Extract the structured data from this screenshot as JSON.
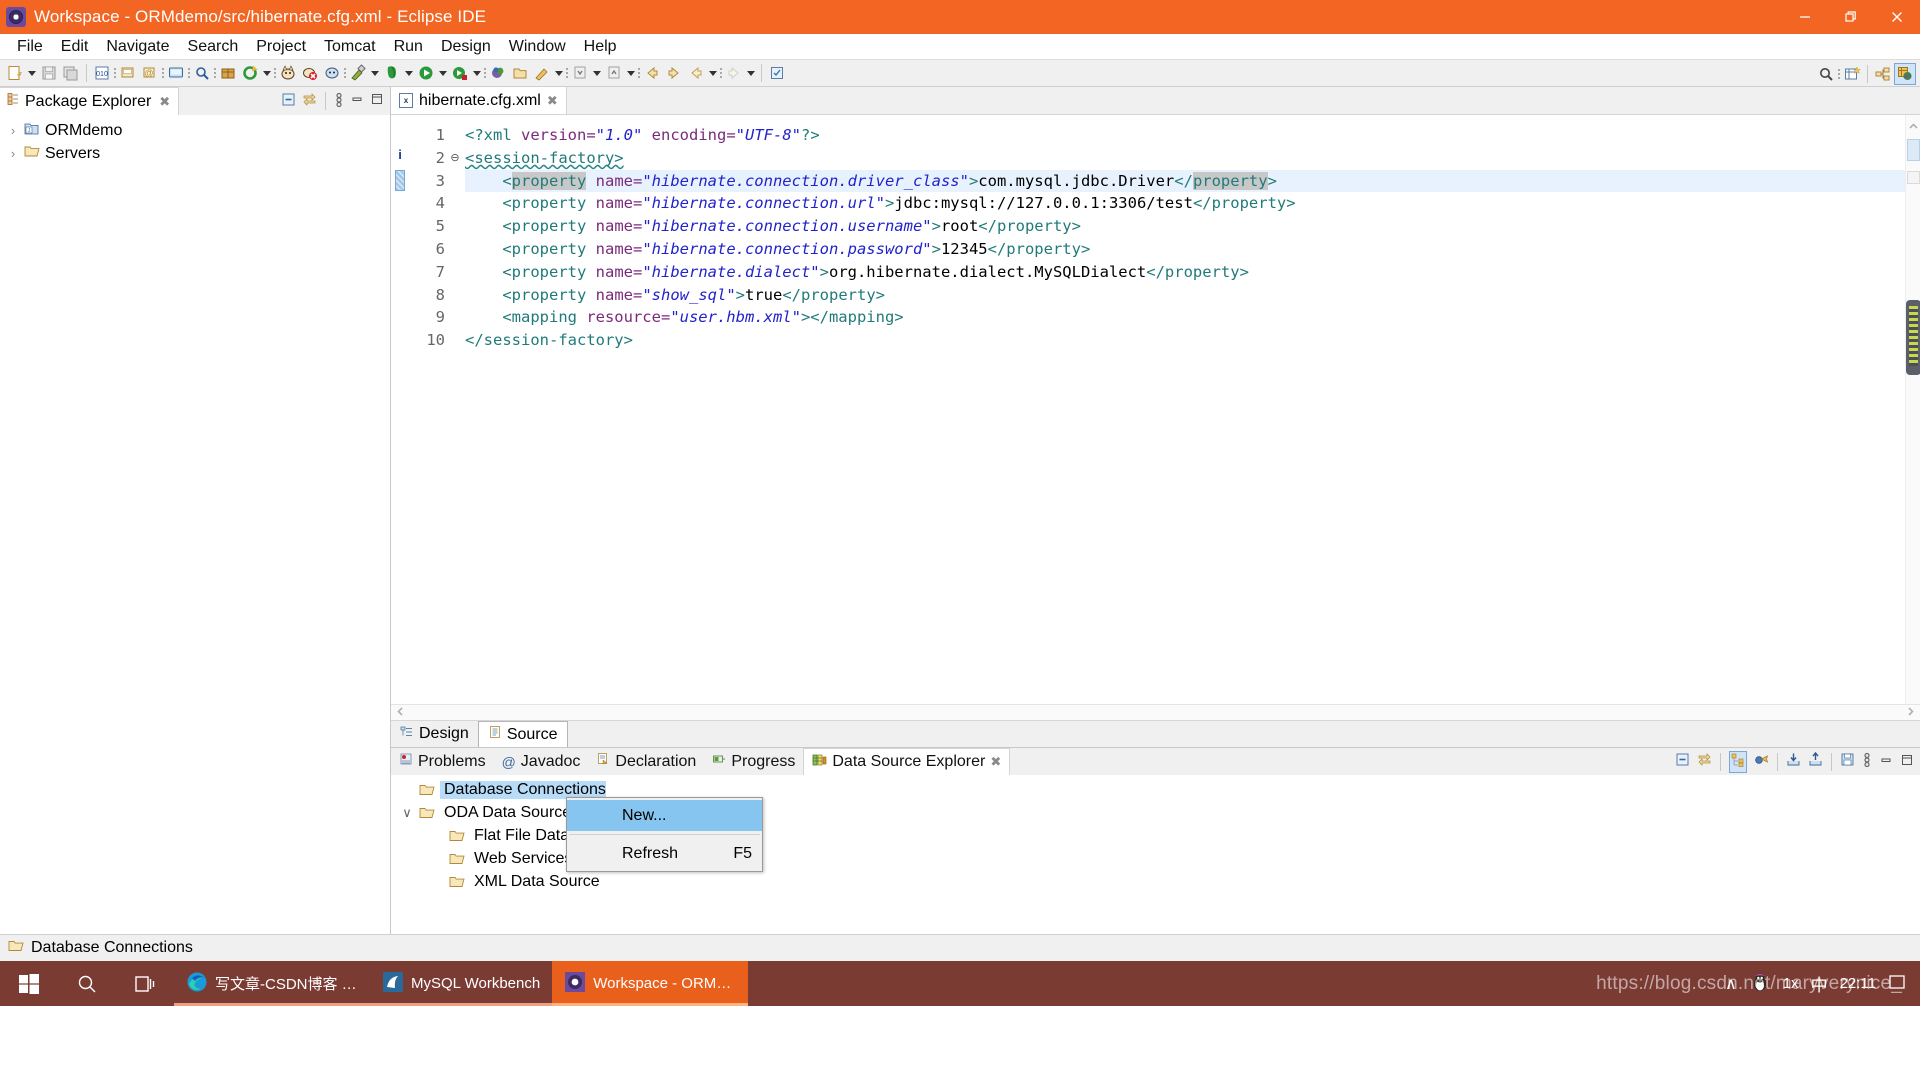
{
  "window": {
    "title": "Workspace - ORMdemo/src/hibernate.cfg.xml - Eclipse IDE",
    "app_icon": "eclipse-icon",
    "minimize_label": "Minimize",
    "restore_label": "Restore",
    "close_label": "Close",
    "accent_color": "#f26522"
  },
  "menubar": {
    "items": [
      {
        "label": "File"
      },
      {
        "label": "Edit"
      },
      {
        "label": "Navigate"
      },
      {
        "label": "Search"
      },
      {
        "label": "Project"
      },
      {
        "label": "Tomcat"
      },
      {
        "label": "Run"
      },
      {
        "label": "Design"
      },
      {
        "label": "Window"
      },
      {
        "label": "Help"
      }
    ]
  },
  "toolbar": {
    "right_icons": [
      "search-icon",
      "new-perspective-icon",
      "java-ee-perspective-icon",
      "web-perspective-icon"
    ]
  },
  "package_explorer": {
    "tab_label": "Package Explorer",
    "tab_icon": "package-explorer-icon",
    "close_label": "✖",
    "tools": [
      "collapse-all-icon",
      "link-with-editor-icon",
      "view-menu-icon",
      "minimize-icon",
      "maximize-icon"
    ],
    "tree": [
      {
        "label": "ORMdemo",
        "twisty": "›",
        "icon": "java-project-icon",
        "expanded": false
      },
      {
        "label": "Servers",
        "twisty": "›",
        "icon": "folder-icon",
        "expanded": false
      }
    ]
  },
  "editor": {
    "tab_label": "hibernate.cfg.xml",
    "tab_icon": "xml-file-icon",
    "tab_icon_text": "x",
    "close_label": "✖",
    "annotation_marker": "i",
    "line_numbers": [
      "1",
      "2",
      "3",
      "4",
      "5",
      "6",
      "7",
      "8",
      "9",
      "10"
    ],
    "fold_markers": {
      "2": "⊖"
    },
    "highlighted_line": 3,
    "lines": [
      {
        "n": 1,
        "segments": [
          {
            "t": "tag",
            "s": "<?xml "
          },
          {
            "t": "att",
            "s": "version="
          },
          {
            "t": "val",
            "s": "\"1.0\""
          },
          {
            "t": "att",
            "s": " encoding="
          },
          {
            "t": "val",
            "s": "\"UTF-8\""
          },
          {
            "t": "tag",
            "s": "?>"
          }
        ]
      },
      {
        "n": 2,
        "segments": [
          {
            "t": "tag-squiggle",
            "s": "<session-factory>"
          }
        ]
      },
      {
        "n": 3,
        "segments": [
          {
            "t": "plain",
            "s": "    "
          },
          {
            "t": "tag",
            "s": "<"
          },
          {
            "t": "tag-sel",
            "s": "property"
          },
          {
            "t": "att",
            "s": " name="
          },
          {
            "t": "val",
            "s": "\"hibernate.connection.driver_class\""
          },
          {
            "t": "tag",
            "s": ">"
          },
          {
            "t": "txt",
            "s": "com.mysql.jdbc.Driver"
          },
          {
            "t": "tag",
            "s": "</"
          },
          {
            "t": "tag-sel",
            "s": "property"
          },
          {
            "t": "tag",
            "s": ">"
          }
        ]
      },
      {
        "n": 4,
        "segments": [
          {
            "t": "plain",
            "s": "    "
          },
          {
            "t": "tag",
            "s": "<property"
          },
          {
            "t": "att",
            "s": " name="
          },
          {
            "t": "val",
            "s": "\"hibernate.connection.url\""
          },
          {
            "t": "tag",
            "s": ">"
          },
          {
            "t": "txt",
            "s": "jdbc:mysql://127.0.0.1:3306/test"
          },
          {
            "t": "tag",
            "s": "</property>"
          }
        ]
      },
      {
        "n": 5,
        "segments": [
          {
            "t": "plain",
            "s": "    "
          },
          {
            "t": "tag",
            "s": "<property"
          },
          {
            "t": "att",
            "s": " name="
          },
          {
            "t": "val",
            "s": "\"hibernate.connection.username\""
          },
          {
            "t": "tag",
            "s": ">"
          },
          {
            "t": "txt",
            "s": "root"
          },
          {
            "t": "tag",
            "s": "</property>"
          }
        ]
      },
      {
        "n": 6,
        "segments": [
          {
            "t": "plain",
            "s": "    "
          },
          {
            "t": "tag",
            "s": "<property"
          },
          {
            "t": "att",
            "s": " name="
          },
          {
            "t": "val",
            "s": "\"hibernate.connection.password\""
          },
          {
            "t": "tag",
            "s": ">"
          },
          {
            "t": "txt",
            "s": "12345"
          },
          {
            "t": "tag",
            "s": "</property>"
          }
        ]
      },
      {
        "n": 7,
        "segments": [
          {
            "t": "plain",
            "s": "    "
          },
          {
            "t": "tag",
            "s": "<property"
          },
          {
            "t": "att",
            "s": " name="
          },
          {
            "t": "val",
            "s": "\"hibernate.dialect\""
          },
          {
            "t": "tag",
            "s": ">"
          },
          {
            "t": "txt",
            "s": "org.hibernate.dialect.MySQLDialect"
          },
          {
            "t": "tag",
            "s": "</property>"
          }
        ]
      },
      {
        "n": 8,
        "segments": [
          {
            "t": "plain",
            "s": "    "
          },
          {
            "t": "tag",
            "s": "<property"
          },
          {
            "t": "att",
            "s": " name="
          },
          {
            "t": "val",
            "s": "\"show_sql\""
          },
          {
            "t": "tag",
            "s": ">"
          },
          {
            "t": "txt",
            "s": "true"
          },
          {
            "t": "tag",
            "s": "</property>"
          }
        ]
      },
      {
        "n": 9,
        "segments": [
          {
            "t": "plain",
            "s": "    "
          },
          {
            "t": "tag",
            "s": "<mapping"
          },
          {
            "t": "att",
            "s": " resource="
          },
          {
            "t": "val",
            "s": "\"user.hbm.xml\""
          },
          {
            "t": "tag",
            "s": "></mapping>"
          }
        ]
      },
      {
        "n": 10,
        "segments": [
          {
            "t": "tag",
            "s": "</session-factory>"
          }
        ]
      }
    ],
    "page_tabs": [
      {
        "label": "Design",
        "icon": "design-view-icon",
        "selected": false
      },
      {
        "label": "Source",
        "icon": "source-view-icon",
        "selected": true
      }
    ]
  },
  "bottom_panel": {
    "tabs": [
      {
        "label": "Problems",
        "icon": "problems-icon",
        "selected": false
      },
      {
        "label": "Javadoc",
        "icon": "javadoc-icon",
        "selected": false
      },
      {
        "label": "Declaration",
        "icon": "declaration-icon",
        "selected": false
      },
      {
        "label": "Progress",
        "icon": "progress-icon",
        "selected": false
      },
      {
        "label": "Data Source Explorer",
        "icon": "data-source-explorer-icon",
        "selected": true
      }
    ],
    "close_label": "✖",
    "tools": [
      "collapse-all-icon",
      "link-with-editor-icon",
      "show-categories-icon",
      "manage-drivers-icon",
      "import-icon",
      "export-icon",
      "save-icon",
      "view-menu-icon",
      "minimize-icon",
      "maximize-icon"
    ],
    "tree": [
      {
        "label": "Database Connections",
        "icon": "folder-icon",
        "indent": 1,
        "twisty": "",
        "selected": true
      },
      {
        "label": "ODA Data Sources",
        "icon": "folder-icon",
        "indent": 1,
        "twisty": "∨",
        "selected": false
      },
      {
        "label": "Flat File Data Source",
        "icon": "folder-icon",
        "indent": 2,
        "twisty": "",
        "selected": false
      },
      {
        "label": "Web Services Data Source",
        "icon": "folder-icon",
        "indent": 2,
        "twisty": "",
        "selected": false
      },
      {
        "label": "XML Data Source",
        "icon": "folder-icon",
        "indent": 2,
        "twisty": "",
        "selected": false
      }
    ]
  },
  "context_menu": {
    "items": [
      {
        "label": "New...",
        "accel": "",
        "highlighted": true
      },
      {
        "label": "Refresh",
        "accel": "F5",
        "highlighted": false
      }
    ]
  },
  "status_bar": {
    "icon": "folder-icon",
    "text": "Database Connections"
  },
  "taskbar": {
    "start_label": "start-button",
    "search_label": "search-button",
    "taskview_label": "task-view-button",
    "apps": [
      {
        "label": "写文章-CSDN博客 和...",
        "icon": "edge-icon",
        "active": false,
        "underline": "#f0a080"
      },
      {
        "label": "MySQL Workbench",
        "icon": "mysql-workbench-icon",
        "active": false,
        "underline": "#f0a080"
      },
      {
        "label": "Workspace - ORMd...",
        "icon": "eclipse-icon",
        "active": true,
        "underline": "#ffb380"
      }
    ],
    "tray": {
      "chevron": "∧",
      "qq_icon": "qq-penguin-icon",
      "input_method": "中",
      "scale": "1x",
      "time": "22:11",
      "notification_icon": "notification-icon"
    },
    "watermark": "https://blog.csdn.net/maryverynice_"
  }
}
